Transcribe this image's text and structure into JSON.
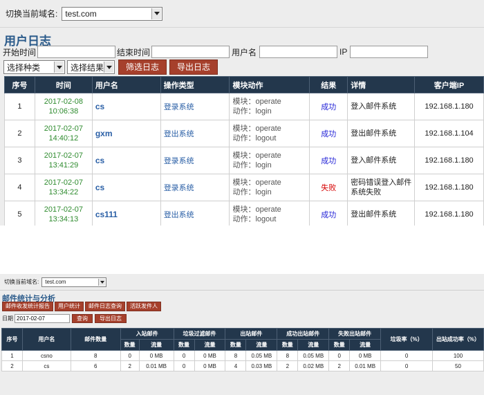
{
  "panel1": {
    "domain_label": "切换当前域名:",
    "domain_value": "test.com",
    "title": "用户日志",
    "filters": {
      "start_label": "开始时间",
      "end_label": "结束时间",
      "user_label": "用户名",
      "ip_label": "IP"
    },
    "select_type": "选择种类",
    "select_result": "选择结果",
    "filter_button": "筛选日志",
    "export_button": "导出日志",
    "columns": [
      "序号",
      "时间",
      "用户名",
      "操作类型",
      "模块动作",
      "结果",
      "详情",
      "客户端IP"
    ],
    "rows": [
      {
        "no": "1",
        "date": "2017-02-08",
        "time": "10:06:38",
        "user": "cs",
        "op": "登录系统",
        "module": "模块：operate",
        "action": "动作：login",
        "result": "成功",
        "detail": "登入邮件系统",
        "ip": "192.168.1.180"
      },
      {
        "no": "2",
        "date": "2017-02-07",
        "time": "14:40:12",
        "user": "gxm",
        "op": "登出系统",
        "module": "模块：operate",
        "action": "动作：logout",
        "result": "成功",
        "detail": "登出邮件系统",
        "ip": "192.168.1.104"
      },
      {
        "no": "3",
        "date": "2017-02-07",
        "time": "13:41:29",
        "user": "cs",
        "op": "登录系统",
        "module": "模块：operate",
        "action": "动作：login",
        "result": "成功",
        "detail": "登入邮件系统",
        "ip": "192.168.1.180"
      },
      {
        "no": "4",
        "date": "2017-02-07",
        "time": "13:34:22",
        "user": "cs",
        "op": "登录系统",
        "module": "模块：operate",
        "action": "动作：login",
        "result": "失败",
        "detail": "密码错误登入邮件系统失败",
        "ip": "192.168.1.180"
      },
      {
        "no": "5",
        "date": "2017-02-07",
        "time": "13:34:13",
        "user": "cs111",
        "op": "登出系统",
        "module": "模块：operate",
        "action": "动作：logout",
        "result": "成功",
        "detail": "登出邮件系统",
        "ip": "192.168.1.180"
      }
    ]
  },
  "panel2": {
    "domain_label": "切换当前域名:",
    "domain_value": "test.com",
    "title": "邮件统计与分析",
    "buttons": [
      "邮件收发统计报告",
      "用户统计",
      "邮件日志查询",
      "活跃发件人"
    ],
    "date_label": "日期",
    "date_value": "2017-02-07",
    "query_button": "查询",
    "export_button": "导出日志",
    "headers": {
      "no": "序号",
      "user": "用户名",
      "count": "邮件数量",
      "groups": [
        "入站邮件",
        "垃圾过滤邮件",
        "出站邮件",
        "成功出站邮件",
        "失败出站邮件"
      ],
      "sub": [
        "数量",
        "流量"
      ],
      "spam_rate": "垃圾率（%）",
      "out_rate": "出站成功率（%）"
    },
    "rows": [
      {
        "no": "1",
        "user": "csno",
        "count": "8",
        "in_n": "0",
        "in_f": "0 MB",
        "sp_n": "0",
        "sp_f": "0 MB",
        "out_n": "8",
        "out_f": "0.05 MB",
        "ok_n": "8",
        "ok_f": "0.05 MB",
        "fail_n": "0",
        "fail_f": "0 MB",
        "spam_rate": "0",
        "out_rate": "100"
      },
      {
        "no": "2",
        "user": "cs",
        "count": "6",
        "in_n": "2",
        "in_f": "0.01 MB",
        "sp_n": "0",
        "sp_f": "0 MB",
        "out_n": "4",
        "out_f": "0.03 MB",
        "ok_n": "2",
        "ok_f": "0.02 MB",
        "fail_n": "2",
        "fail_f": "0.01 MB",
        "spam_rate": "0",
        "out_rate": "50"
      }
    ]
  }
}
